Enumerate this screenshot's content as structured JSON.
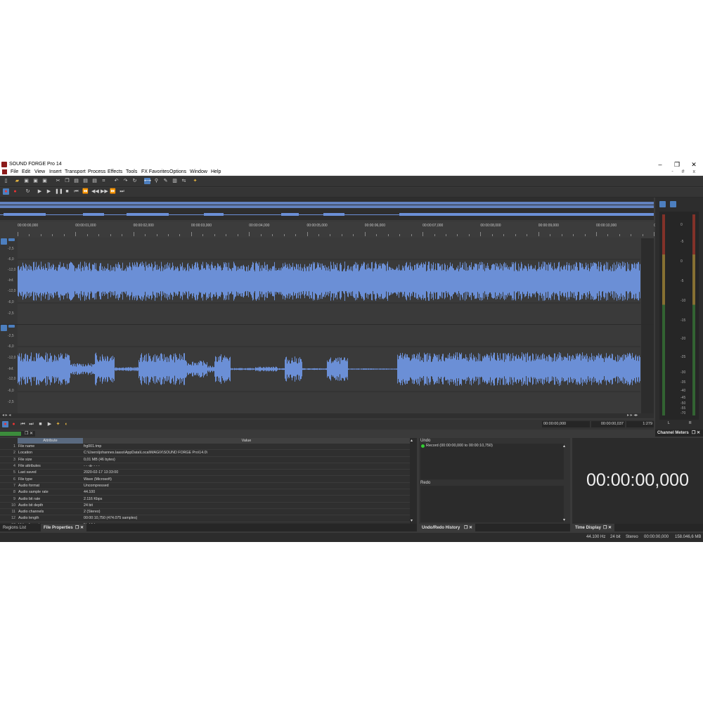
{
  "window": {
    "title": "SOUND FORGE Pro 14",
    "minimize": "–",
    "maximize": "❐",
    "close": "✕"
  },
  "menu": [
    "File",
    "Edit",
    "View",
    "Insert",
    "Transport",
    "Process",
    "Effects",
    "Tools",
    "FX Favorites",
    "Options",
    "Window",
    "Help"
  ],
  "menu_doc_buttons": "- # x",
  "ruler": {
    "labels": [
      "00:00:00,000",
      "00:00:01,000",
      "00:00:02,000",
      "00:00:03,000",
      "00:00:04,000",
      "00:00:05,000",
      "00:00:06,000",
      "00:00:07,000",
      "00:00:08,000",
      "00:00:09,000",
      "00:00:10,000",
      "00:00:11,000"
    ]
  },
  "channel1": {
    "db_labels": [
      "-2,5",
      "-6,0",
      "-12,0",
      "-Inf.",
      "-12,0",
      "-6,0",
      "-2,5"
    ]
  },
  "channel2": {
    "db_labels": [
      "-2,5",
      "-6,0",
      "-12,0",
      "-Inf.",
      "-12,0",
      "-6,0",
      "-2,5"
    ]
  },
  "transport_times": {
    "start": "00:00:00,000",
    "length": "00:00:00,037",
    "ratio": "1:279"
  },
  "meter": {
    "labels": [
      "0",
      "-5",
      "0",
      "-5",
      "-10",
      "-15",
      "-20",
      "-25",
      "-30",
      "-35",
      "-40",
      "-45",
      "-50",
      "-55",
      "-70"
    ],
    "channels": [
      "L",
      "R"
    ],
    "tab": "Channel Meters"
  },
  "file_properties": {
    "header_attr": "Attribute",
    "header_value": "Value",
    "rows": [
      {
        "n": "1",
        "attr": "File name",
        "value": "frg001.tmp"
      },
      {
        "n": "2",
        "attr": "Location",
        "value": "C:\\Users\\johannes.laass\\AppData\\Local\\MAGIX\\SOUND FORGE Pro\\14.0\\"
      },
      {
        "n": "3",
        "attr": "File size",
        "value": "0,01 MB (46 bytes)"
      },
      {
        "n": "4",
        "attr": "File attributes",
        "value": "- - -a- - - -"
      },
      {
        "n": "5",
        "attr": "Last saved",
        "value": "2020-02-17  13:33:00"
      },
      {
        "n": "6",
        "attr": "File type",
        "value": "Wave (Microsoft)"
      },
      {
        "n": "7",
        "attr": "Audio format",
        "value": "Uncompressed"
      },
      {
        "n": "8",
        "attr": "Audio sample rate",
        "value": "44.100"
      },
      {
        "n": "9",
        "attr": "Audio bit rate",
        "value": "2.116 Kbps"
      },
      {
        "n": "10",
        "attr": "Audio bit depth",
        "value": "24 bit"
      },
      {
        "n": "11",
        "attr": "Audio channels",
        "value": "2  (Stereo)"
      },
      {
        "n": "12",
        "attr": "Audio length",
        "value": "00:00:10,750 (474.075 samples)"
      },
      {
        "n": "13",
        "attr": "Video format",
        "value": "No Video"
      }
    ],
    "tabs": [
      "Regions List",
      "File Properties"
    ]
  },
  "undo_panel": {
    "undo_label": "Undo",
    "undo_item": "Record (00:00:00,000 to 00:00:10,750)",
    "redo_label": "Redo",
    "tab": "Undo/Redo History"
  },
  "time_display": {
    "value": "00:00:00,000",
    "tab": "Time Display"
  },
  "statusbar": [
    "44.100 Hz",
    "24 bit",
    "Stereo",
    "00:00:00,000",
    "158.046,6 MB"
  ],
  "colors": {
    "wave": "#6b8fd6",
    "background": "#3a3a3a",
    "highlight": "#4d7fbf"
  }
}
